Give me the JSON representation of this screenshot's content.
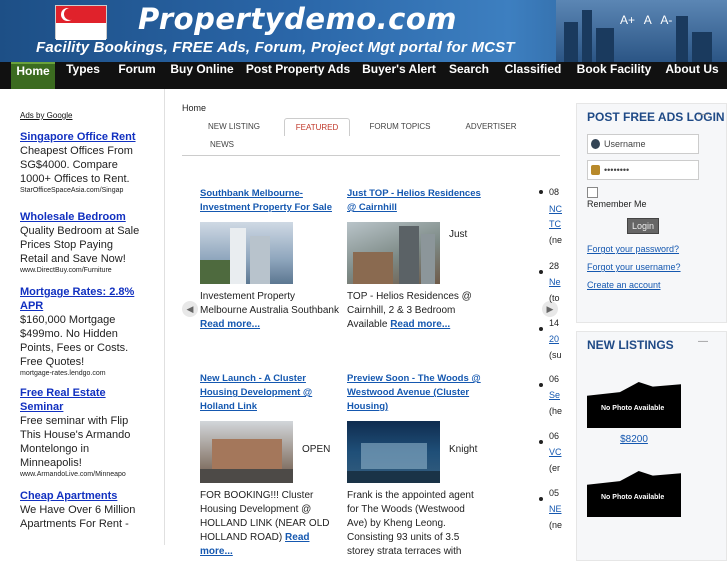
{
  "site": {
    "title": "Propertydemo.com",
    "tagline": "Facility Bookings, FREE Ads, Forum, Project Mgt portal for MCST",
    "font_sizes": [
      "A+",
      "A",
      "A-"
    ]
  },
  "nav": [
    "Home",
    "Types",
    "Forum",
    "Buy Online",
    "Post Property Ads",
    "Buyer's Alert",
    "Search",
    "Classified",
    "Book Facility",
    "About Us"
  ],
  "ads": {
    "header": "Ads by Google",
    "items": [
      {
        "title": "Singapore Office Rent",
        "body": "Cheapest Offices From SG$4000. Compare 1000+ Offices to Rent.",
        "url": "StarOfficeSpaceAsia.com/Singap"
      },
      {
        "title": "Wholesale Bedroom",
        "body": "Quality Bedroom at Sale Prices Stop Paying Retail and Save Now!",
        "url": "www.DirectBuy.com/Furniture"
      },
      {
        "title": "Mortgage Rates: 2.8% APR",
        "body": "$160,000 Mortgage $499mo. No Hidden Points, Fees or Costs. Free Quotes!",
        "url": "mortgage-rates.lendgo.com"
      },
      {
        "title": "Free Real Estate Seminar",
        "body": "Free seminar with Flip This House's Armando Montelongo in Minneapolis!",
        "url": "www.ArmandoLive.com/Minneapo"
      },
      {
        "title": "Cheap Apartments",
        "body": "We Have Over 6 Million Apartments For Rent -"
      }
    ]
  },
  "main": {
    "crumb": "Home",
    "tabs": [
      "NEW LISTING",
      "FEATURED",
      "FORUM TOPICS",
      "ADVERTISER",
      "NEWS"
    ],
    "cards": [
      {
        "title": "Southbank Melbourne- Investment Property For Sale",
        "caption": "",
        "desc": "Investement Property Melbourne Australia Southbank",
        "more": "Read more..."
      },
      {
        "title": "Just TOP - Helios Residences @ Cairnhill",
        "caption": "Just",
        "desc": "TOP - Helios Residences @ Cairnhill, 2 & 3 Bedroom Available",
        "more": "Read more..."
      },
      {
        "title": "New Launch - A Cluster Housing Development @ Holland Link",
        "caption": "OPEN",
        "desc": "FOR BOOKING!!! Cluster Housing Development @ HOLLAND LINK (NEAR OLD HOLLAND ROAD)",
        "more": "Read more..."
      },
      {
        "title": "Preview Soon - The Woods @ Westwood Avenue (Cluster Housing)",
        "caption": "Knight",
        "desc": "Frank is the appointed agent for The Woods (Westwood Ave) by Kheng Leong. Consisting 93 units of 3.5 storey strata terraces with",
        "more": ""
      }
    ],
    "ticker": [
      {
        "date": "08",
        "l1": "NC",
        "l2": "TC",
        "s": "(ne"
      },
      {
        "date": "28",
        "l1": "Ne",
        "l2": "",
        "s": "(to"
      },
      {
        "date": "14",
        "l1": "20",
        "l2": "",
        "s": "(su"
      },
      {
        "date": "06",
        "l1": "Se",
        "l2": "",
        "s": "(he"
      },
      {
        "date": "06",
        "l1": "VC",
        "l2": "",
        "s": "(er"
      },
      {
        "date": "05",
        "l1": "NE",
        "l2": "",
        "s": "(ne"
      }
    ]
  },
  "login": {
    "title": "POST FREE ADS LOGIN",
    "username_placeholder": "Username",
    "password_value": "••••••••",
    "remember": "Remember Me",
    "button": "Login",
    "links": [
      "Forgot your password?",
      "Forgot your username?",
      "Create an account"
    ]
  },
  "listings": {
    "title": "NEW LISTINGS",
    "items": [
      {
        "photo": "No Photo Available",
        "price": "$8200"
      },
      {
        "photo": "No Photo Available",
        "price": ""
      }
    ]
  }
}
